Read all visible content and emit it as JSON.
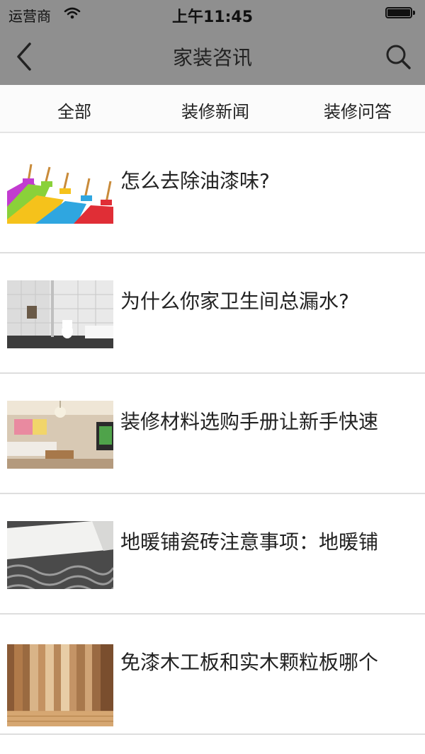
{
  "status_bar": {
    "carrier": "运营商",
    "time": "上午11:45"
  },
  "nav": {
    "title": "家装咨讯",
    "back_icon": "chevron-left-icon",
    "search_icon": "search-icon"
  },
  "tabs": [
    {
      "label": "全部"
    },
    {
      "label": "装修新闻"
    },
    {
      "label": "装修问答"
    }
  ],
  "articles": [
    {
      "title": "怎么去除油漆味?",
      "thumbnail": "paint-rollers-image"
    },
    {
      "title": "为什么你家卫生间总漏水?",
      "thumbnail": "bathroom-image"
    },
    {
      "title": "装修材料选购手册让新手快速",
      "thumbnail": "living-room-image"
    },
    {
      "title": "地暖铺瓷砖注意事项：地暖铺",
      "thumbnail": "floor-heating-image"
    },
    {
      "title": "免漆木工板和实木颗粒板哪个",
      "thumbnail": "wood-planks-image"
    }
  ],
  "colors": {
    "header_bg": "#8f8f8f",
    "divider": "#dedede",
    "text": "#222222"
  }
}
